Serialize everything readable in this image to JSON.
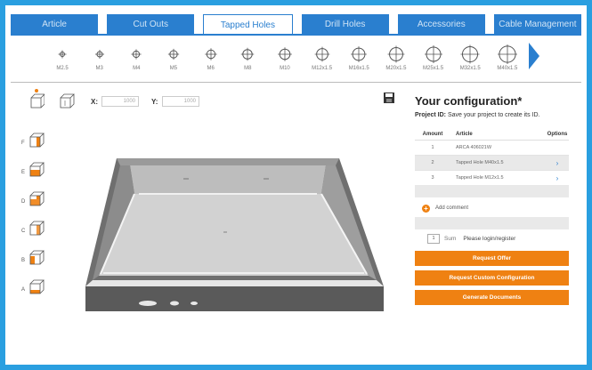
{
  "tabs": [
    "Article",
    "Cut Outs",
    "Tapped Holes",
    "Drill Holes",
    "Accessories",
    "Cable Management"
  ],
  "active_tab": "Tapped Holes",
  "sizes": [
    "M2.5",
    "M3",
    "M4",
    "M5",
    "M6",
    "M8",
    "M10",
    "M12x1.5",
    "M16x1.5",
    "M20x1.5",
    "M25x1.5",
    "M32x1.5",
    "M40x1.5"
  ],
  "coords": {
    "x_label": "X:",
    "x_value": "1000",
    "y_label": "Y:",
    "y_value": "1000"
  },
  "side_letters": [
    "F",
    "E",
    "D",
    "C",
    "B",
    "A"
  ],
  "config": {
    "title": "Your configuration*",
    "project_label": "Project ID:",
    "project_hint": "Save your project to create its ID.",
    "col_amount": "Amount",
    "col_article": "Article",
    "col_options": "Options",
    "rows": [
      {
        "amount": "1",
        "article": "ARCA 406021W",
        "options": ""
      },
      {
        "amount": "2",
        "article": "Tapped Hole M40x1.5",
        "options": "›"
      },
      {
        "amount": "3",
        "article": "Tapped Hole M12x1.5",
        "options": "›"
      }
    ],
    "add_comment": "Add comment",
    "sum_count": "1",
    "sum_label": "Sum",
    "login_text": "Please login/register",
    "buttons": [
      "Request Offer",
      "Request Custom Configuration",
      "Generate Documents"
    ]
  },
  "colors": {
    "accent_blue": "#2a7fcf",
    "frame_blue": "#2a9fe0",
    "orange": "#ef8112"
  }
}
